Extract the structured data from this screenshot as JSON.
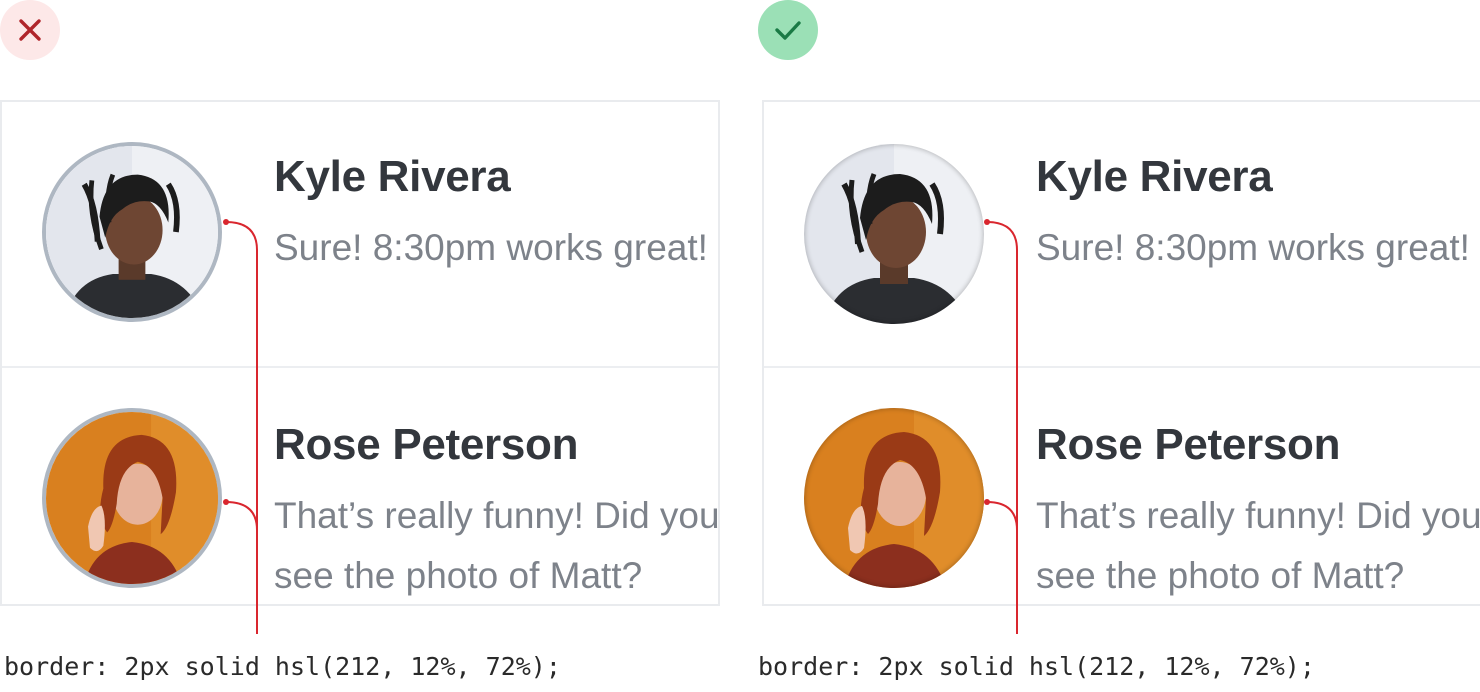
{
  "panels": [
    {
      "verdict_icon": "close-icon",
      "verdict_color": "#b0252b",
      "verdict_bg": "#fde8e8",
      "style": "bordered",
      "code": "border: 2px solid hsl(212, 12%, 72%);"
    },
    {
      "verdict_icon": "check-icon",
      "verdict_color": "#1a7a45",
      "verdict_bg": "#9be0b6",
      "style": "inset-shadow",
      "code": "border: 2px solid hsl(212, 12%, 72%);"
    }
  ],
  "conversations": [
    {
      "name": "Kyle Rivera",
      "message": "Sure! 8:30pm works great!",
      "avatar": "man-portrait"
    },
    {
      "name": "Rose Peterson",
      "message": "That’s really funny! Did you see the photo of Matt?",
      "avatar": "woman-portrait"
    }
  ],
  "colors": {
    "annotation_line": "#d9262e",
    "avatar_border": "#aeb7c2",
    "name": "#33373d",
    "message": "#7d828a"
  }
}
